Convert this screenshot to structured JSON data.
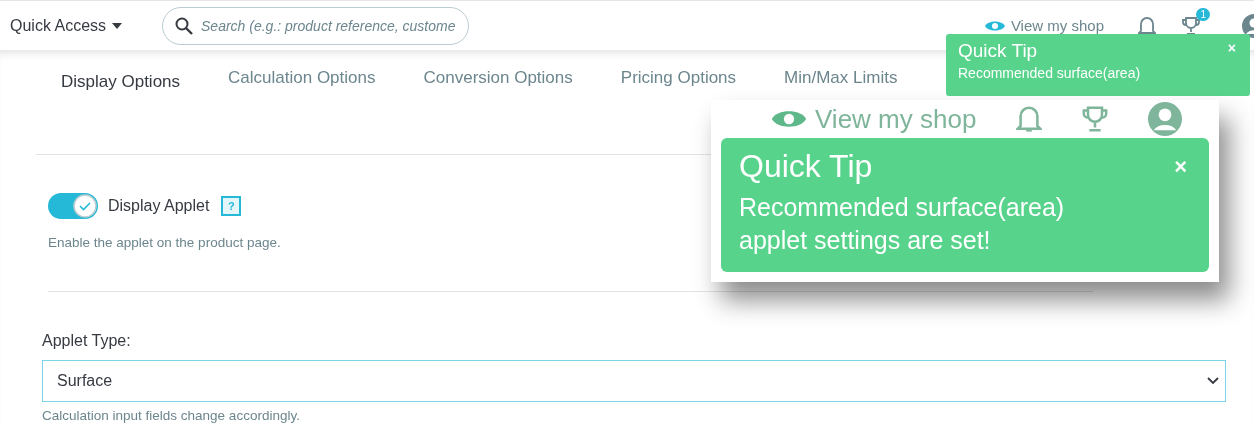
{
  "header": {
    "quick_access": "Quick Access",
    "search": {
      "placeholder": "Search (e.g.: product reference, custome"
    },
    "view_shop": "View my shop",
    "notification_badge": "1"
  },
  "tabs": [
    {
      "label": "Display Options",
      "selected": true
    },
    {
      "label": "Calculation Options",
      "selected": false
    },
    {
      "label": "Conversion Options",
      "selected": false
    },
    {
      "label": "Pricing Options",
      "selected": false
    },
    {
      "label": "Min/Max Limits",
      "selected": false
    }
  ],
  "toast": {
    "title": "Quick Tip",
    "message": "Recommended surface(area)",
    "close": "×"
  },
  "callout": {
    "view_shop": "View my shop",
    "toast": {
      "title": "Quick Tip",
      "message": "Recommended surface(area) applet settings are set!",
      "close": "×"
    }
  },
  "display_applet": {
    "label": "Display Applet",
    "on": true,
    "help": "?",
    "description": "Enable the applet on the product page."
  },
  "applet_type": {
    "label": "Applet Type:",
    "value": "Surface",
    "hint": "Calculation input fields change accordingly."
  }
}
